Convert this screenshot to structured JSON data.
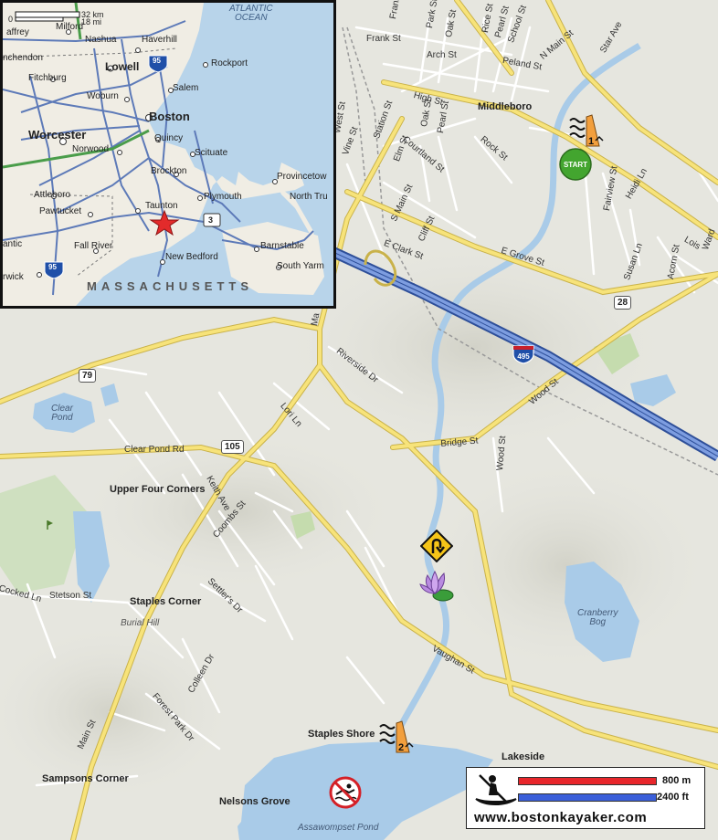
{
  "map": {
    "towns": [
      {
        "id": "middleboro",
        "label": "Middleboro"
      },
      {
        "id": "upper-four-corners",
        "label": "Upper Four Corners"
      },
      {
        "id": "staples-corner",
        "label": "Staples Corner"
      },
      {
        "id": "staples-shore",
        "label": "Staples Shore"
      },
      {
        "id": "sampsons-corner",
        "label": "Sampsons Corner"
      },
      {
        "id": "nelsons-grove",
        "label": "Nelsons Grove"
      },
      {
        "id": "lakeside",
        "label": "Lakeside"
      }
    ],
    "water_labels": [
      {
        "id": "clear-pond",
        "label": "Clear\nPond"
      },
      {
        "id": "cranberry-bog",
        "label": "Cranberry\nBog"
      },
      {
        "id": "assawompset-pond",
        "label": "Assawompset Pond"
      }
    ],
    "features": [
      {
        "id": "burial-hill",
        "label": "Burial Hill"
      }
    ],
    "streets": [
      "Frank St",
      "Park St",
      "Oak St",
      "Rice St",
      "Pearl St",
      "School St",
      "N Main St",
      "Star Ave",
      "Arch St",
      "Peland St",
      "High St",
      "Oak St",
      "Pearl St",
      "Station St",
      "West St",
      "Vine St",
      "Elm St",
      "Courtland St",
      "Rock St",
      "S Main St",
      "E Clark St",
      "Cliff St",
      "E Grove St",
      "Fairview St",
      "Heidi Ln",
      "Susan Ln",
      "Acorn St",
      "Lois",
      "Ward",
      "Riverside Dr",
      "Lori Ln",
      "Wood St",
      "Bridge St",
      "Wood St",
      "Clear Pond Rd",
      "Keith Ave",
      "Coombs St",
      "Settler's Dr",
      "Stetson St",
      "Cocked Ln",
      "Vaughan St",
      "Colleen Dr",
      "Forest Park Dr",
      "Main St",
      "Ma"
    ],
    "route_shields": [
      "79",
      "105",
      "28"
    ],
    "interstate": "495",
    "markers": {
      "start_label": "START",
      "waypoint_1": "1",
      "waypoint_2": "2"
    },
    "icons": [
      "u-turn-sign-icon",
      "water-lily-icon",
      "no-swimming-sign-icon",
      "kayaker-icon",
      "golf-flag-icon"
    ]
  },
  "inset": {
    "scale_km": "32 km",
    "scale_mi": "18 mi",
    "scale_zero": "0",
    "ocean": "ATLANTIC\nOCEAN",
    "state": "MASSACHUSETTS",
    "cities": [
      {
        "id": "jaffrey",
        "label": "affrey"
      },
      {
        "id": "milford",
        "label": "Milford"
      },
      {
        "id": "nashua",
        "label": "Nashua"
      },
      {
        "id": "haverhill",
        "label": "Haverhill"
      },
      {
        "id": "winchendon",
        "label": "nchendon"
      },
      {
        "id": "lowell",
        "label": "Lowell"
      },
      {
        "id": "rockport",
        "label": "Rockport"
      },
      {
        "id": "fitchburg",
        "label": "Fitchburg"
      },
      {
        "id": "salem",
        "label": "Salem"
      },
      {
        "id": "woburn",
        "label": "Woburn"
      },
      {
        "id": "boston",
        "label": "Boston"
      },
      {
        "id": "worcester",
        "label": "Worcester"
      },
      {
        "id": "quincy",
        "label": "Quincy"
      },
      {
        "id": "norwood",
        "label": "Norwood"
      },
      {
        "id": "scituate",
        "label": "Scituate"
      },
      {
        "id": "brockton",
        "label": "Brockton"
      },
      {
        "id": "provincetown",
        "label": "Provincetow"
      },
      {
        "id": "attleboro",
        "label": "Attleboro"
      },
      {
        "id": "plymouth",
        "label": "Plymouth"
      },
      {
        "id": "north-truro",
        "label": "North Tru"
      },
      {
        "id": "pawtucket",
        "label": "Pawtucket"
      },
      {
        "id": "taunton",
        "label": "Taunton"
      },
      {
        "id": "antic",
        "label": "antic"
      },
      {
        "id": "fall-river",
        "label": "Fall River"
      },
      {
        "id": "new-bedford",
        "label": "New Bedford"
      },
      {
        "id": "barnstable",
        "label": "Barnstable"
      },
      {
        "id": "warwick",
        "label": "rwick"
      },
      {
        "id": "south-yarmouth",
        "label": "South Yarm"
      }
    ],
    "shields": [
      "95",
      "3",
      "95"
    ]
  },
  "legend": {
    "metric": "800 m",
    "imperial": "2400 ft",
    "url": "www.bostonkayaker.com",
    "metric_color": "#e8262b",
    "imperial_color": "#3b5fd9"
  },
  "colors": {
    "land": "#e6e6df",
    "water": "#a9cbe8",
    "major_road": "#f7e37a",
    "interstate": "#5a7fd1",
    "minor_road": "#ffffff",
    "marker_orange": "#f29f3d",
    "start_green": "#43a52f"
  }
}
